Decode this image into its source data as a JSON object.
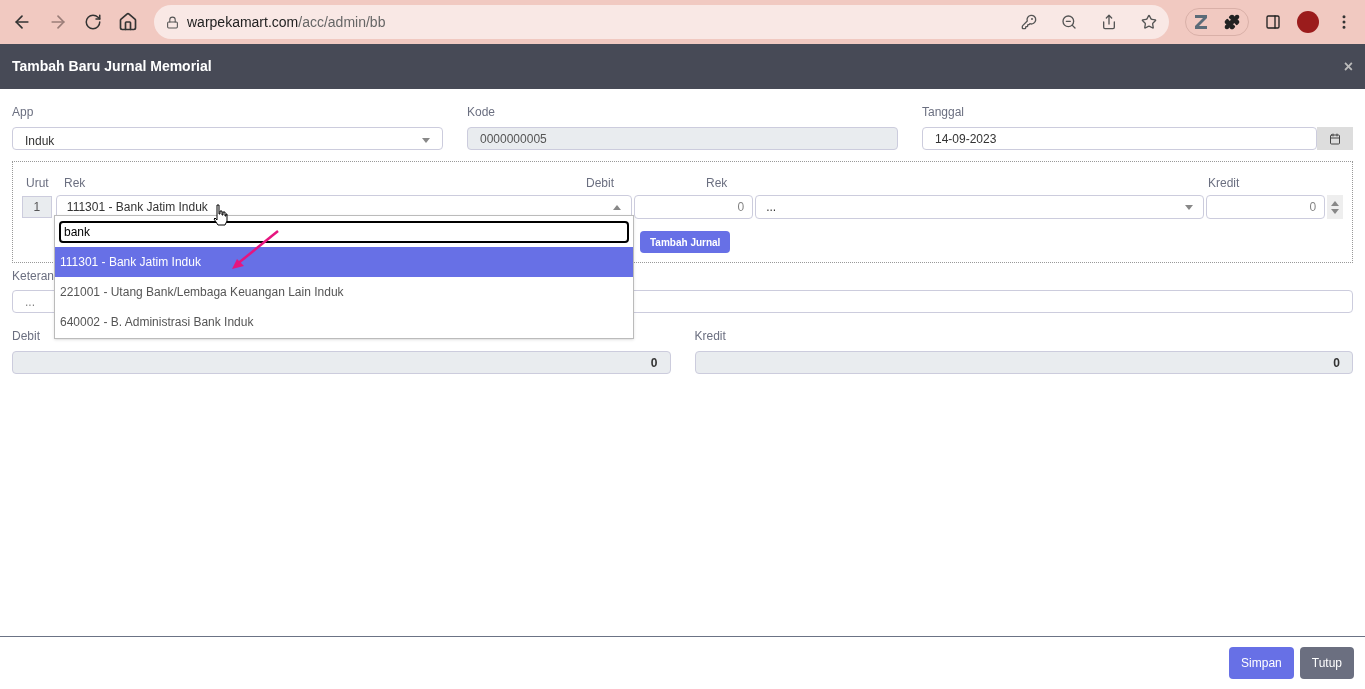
{
  "browser": {
    "url_host": "warpekamart.com",
    "url_path": "/acc/admin/bb",
    "forward_disabled": true
  },
  "modal": {
    "title": "Tambah Baru Jurnal Memorial",
    "close": "×"
  },
  "form": {
    "app": {
      "label": "App",
      "value": "Induk"
    },
    "kode": {
      "label": "Kode",
      "value": "0000000005"
    },
    "tanggal": {
      "label": "Tanggal",
      "value": "14-09-2023"
    }
  },
  "journal": {
    "headers": {
      "urut": "Urut",
      "rek": "Rek",
      "debit": "Debit",
      "rek2": "Rek",
      "kredit": "Kredit"
    },
    "row": {
      "urut": "1",
      "rek": "111301 - Bank Jatim Induk",
      "debit_placeholder": "0",
      "rek2": "...",
      "kredit_placeholder": "0"
    },
    "add_button": "Tambah Jurnal"
  },
  "dropdown": {
    "search": "bank",
    "options": [
      {
        "label": "111301 - Bank Jatim Induk",
        "selected": true
      },
      {
        "label": "221001 - Utang Bank/Lembaga Keuangan Lain Induk",
        "selected": false
      },
      {
        "label": "640002 - B. Administrasi Bank Induk",
        "selected": false
      }
    ]
  },
  "keterangan": {
    "label": "Keteran",
    "placeholder": "..."
  },
  "totals": {
    "debit": {
      "label": "Debit",
      "value": "0"
    },
    "kredit": {
      "label": "Kredit",
      "value": "0"
    }
  },
  "footer": {
    "buttons": [
      {
        "label": "Simpan",
        "kind": "primary"
      },
      {
        "label": "Tutup",
        "kind": "secondary"
      }
    ]
  }
}
